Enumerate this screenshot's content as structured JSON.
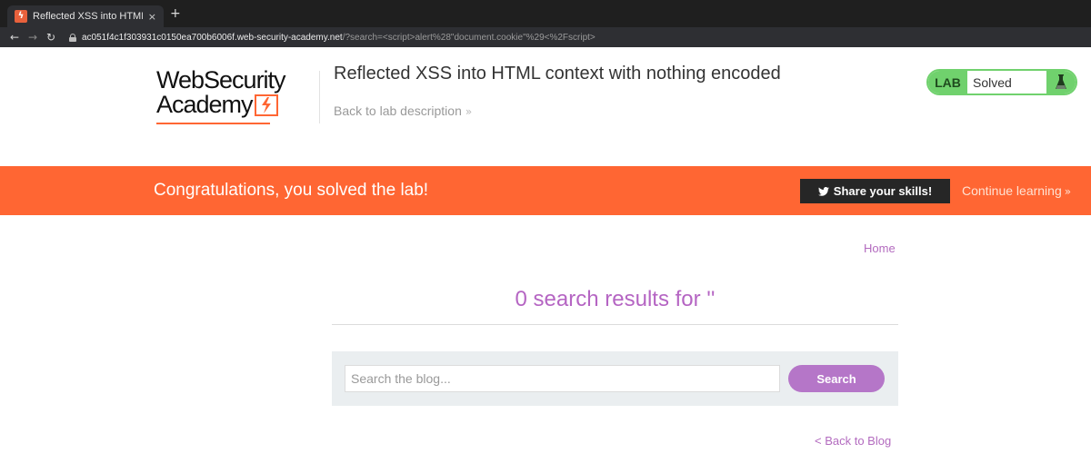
{
  "browser": {
    "tab_title": "Reflected XSS into HTML",
    "tab_close": "×",
    "new_tab": "+",
    "favicon_glyph": "ϟ",
    "url_host": "ac051f4c1f303931c0150ea700b6006f.web-security-academy.net",
    "url_path": "/?search=<script>alert%28\"document.cookie\"%29<%2Fscript>"
  },
  "header": {
    "logo_line1": "WebSecurity",
    "logo_line2": "Academy",
    "lab_title": "Reflected XSS into HTML context with nothing encoded",
    "back_to_description": "Back to lab description",
    "back_chevron": "»",
    "lab_label": "LAB",
    "lab_status": "Solved"
  },
  "banner": {
    "message": "Congratulations, you solved the lab!",
    "share_label": "Share your skills!",
    "continue_label": "Continue learning",
    "continue_chevron": "»"
  },
  "content": {
    "home_link": "Home",
    "results_title": "0 search results for ''",
    "search_placeholder": "Search the blog...",
    "search_button": "Search",
    "back_to_blog": "< Back to Blog"
  },
  "colors": {
    "accent": "#ff6633",
    "lab_green": "#70d16d",
    "link_purple": "#b36bbf",
    "button_purple": "#b576c8"
  }
}
